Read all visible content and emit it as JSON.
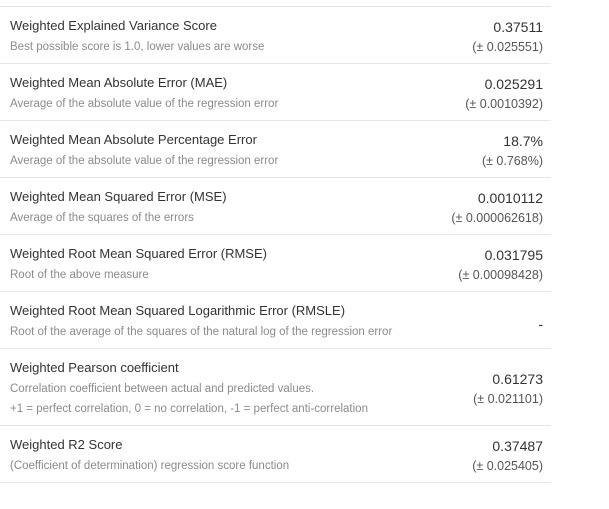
{
  "metrics": [
    {
      "name": "Weighted Explained Variance Score",
      "description": [
        "Best possible score is 1.0, lower values are worse"
      ],
      "value": "0.37511",
      "std": "(± 0.025551)"
    },
    {
      "name": "Weighted Mean Absolute Error (MAE)",
      "description": [
        "Average of the absolute value of the regression error"
      ],
      "value": "0.025291",
      "std": "(± 0.0010392)"
    },
    {
      "name": "Weighted Mean Absolute Percentage Error",
      "description": [
        "Average of the absolute value of the regression error"
      ],
      "value": "18.7%",
      "std": "(± 0.768%)"
    },
    {
      "name": "Weighted Mean Squared Error (MSE)",
      "description": [
        "Average of the squares of the errors"
      ],
      "value": "0.0010112",
      "std": "(± 0.000062618)"
    },
    {
      "name": "Weighted Root Mean Squared Error (RMSE)",
      "description": [
        "Root of the above measure"
      ],
      "value": "0.031795",
      "std": "(± 0.00098428)"
    },
    {
      "name": "Weighted Root Mean Squared Logarithmic Error (RMSLE)",
      "description": [
        "Root of the average of the squares of the natural log of the regression error"
      ],
      "value": "-",
      "std": ""
    },
    {
      "name": "Weighted Pearson coefficient",
      "description": [
        "Correlation coefficient between actual and predicted values.",
        "+1 = perfect correlation, 0 = no correlation, -1 = perfect anti-correlation"
      ],
      "value": "0.61273",
      "std": "(± 0.021101)"
    },
    {
      "name": "Weighted R2 Score",
      "description": [
        "(Coefficient of determination) regression score function"
      ],
      "value": "0.37487",
      "std": "(± 0.025405)"
    }
  ]
}
